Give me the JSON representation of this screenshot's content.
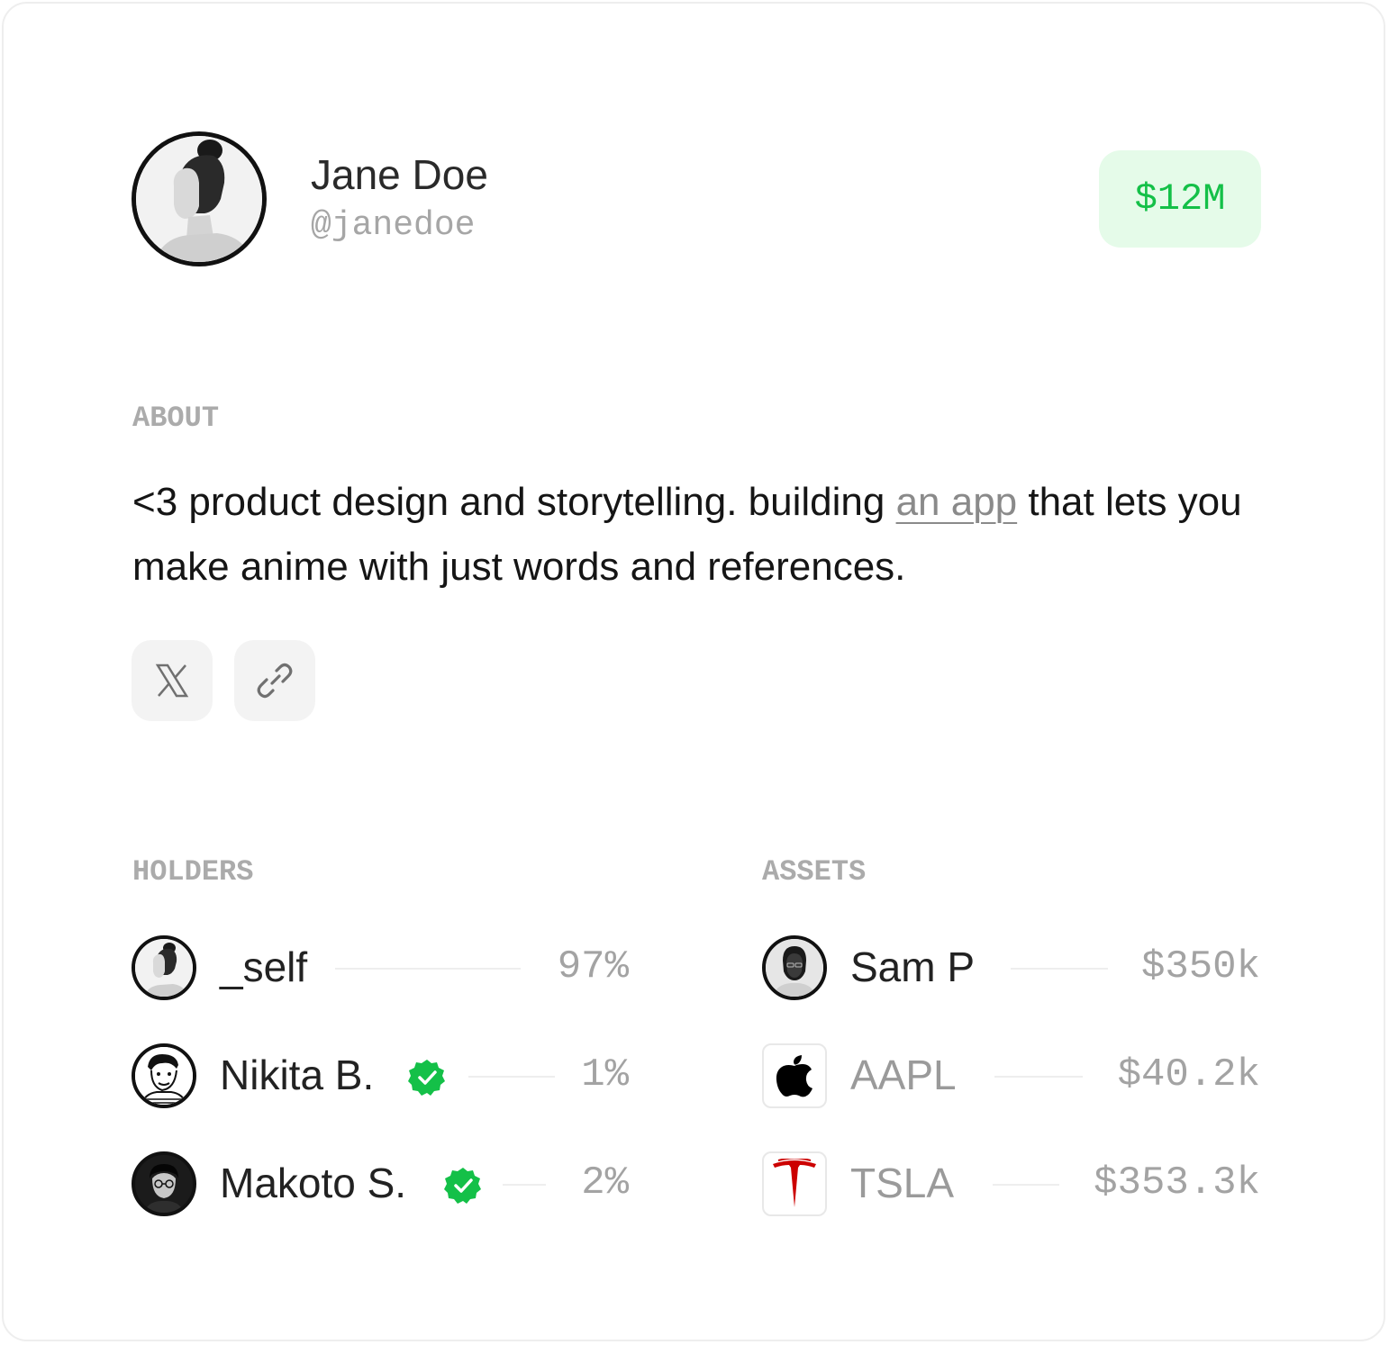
{
  "profile": {
    "name": "Jane Doe",
    "handle": "@janedoe",
    "value": "$12M"
  },
  "about": {
    "label": "ABOUT",
    "text_before": "<3 product design and storytelling. building ",
    "link_text": "an app",
    "text_after": " that lets you make anime with just words and references."
  },
  "social": [
    {
      "icon": "x-logo-icon"
    },
    {
      "icon": "link-icon"
    }
  ],
  "holders": {
    "label": "HOLDERS",
    "items": [
      {
        "name": "_self",
        "value": "97%",
        "verified": false
      },
      {
        "name": "Nikita B.",
        "value": "1%",
        "verified": true
      },
      {
        "name": "Makoto S.",
        "value": "2%",
        "verified": true
      }
    ]
  },
  "assets": {
    "label": "ASSETS",
    "items": [
      {
        "name": "Sam P",
        "value": "$350k",
        "type": "person"
      },
      {
        "name": "AAPL",
        "value": "$40.2k",
        "type": "stock",
        "icon": "apple-logo-icon"
      },
      {
        "name": "TSLA",
        "value": "$353.3k",
        "type": "stock",
        "icon": "tesla-logo-icon"
      }
    ]
  },
  "colors": {
    "accent_green": "#14c048",
    "badge_bg": "#e5fbe9",
    "tesla_red": "#cc0000"
  }
}
